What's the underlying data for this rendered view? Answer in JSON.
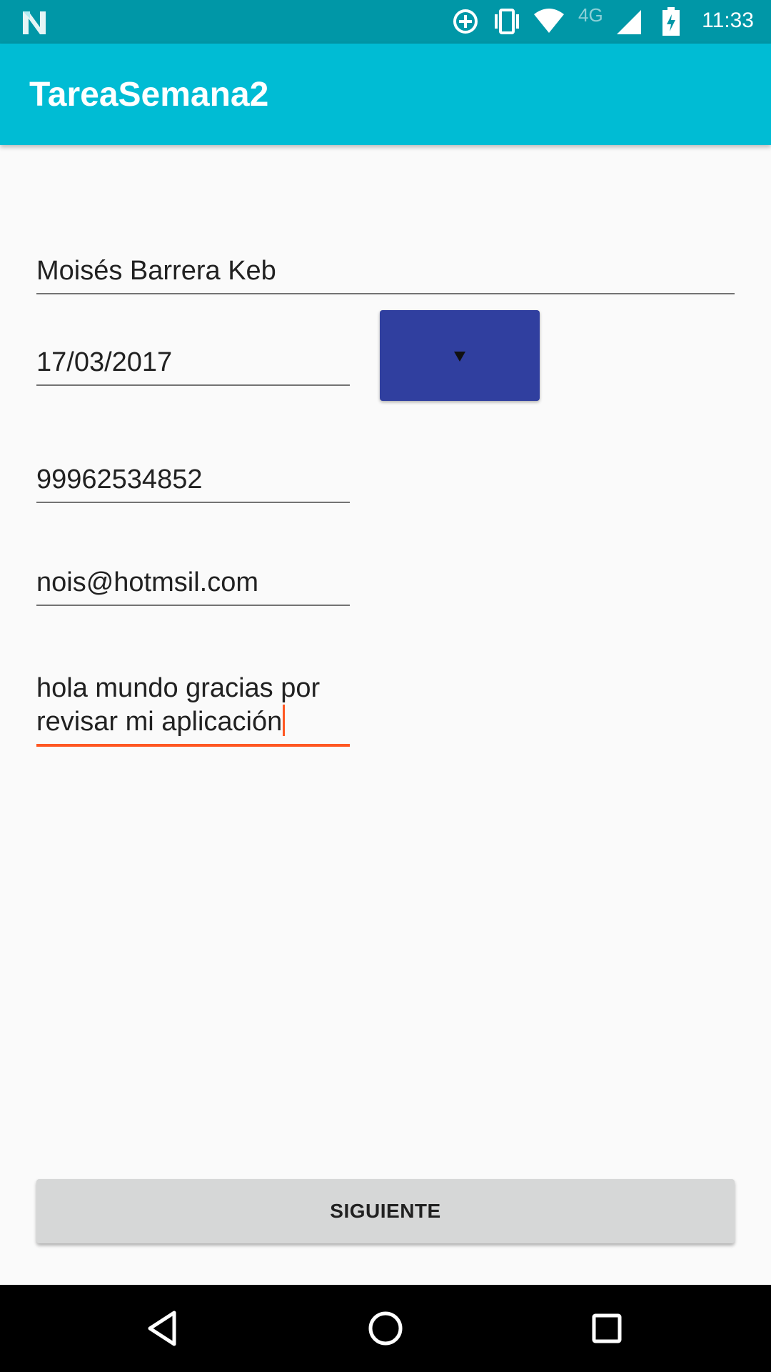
{
  "status_bar": {
    "time": "11:33",
    "network": "4G",
    "icons": [
      "n-logo-icon",
      "data-saver-icon",
      "vibrate-icon",
      "wifi-icon",
      "signal-icon",
      "battery-icon"
    ]
  },
  "app_bar": {
    "title": "TareaSemana2"
  },
  "form": {
    "name": "Moisés Barrera Keb",
    "date": "17/03/2017",
    "phone": "99962534852",
    "email": "nois@hotmsil.com",
    "description": "hola mundo gracias por\nrevisar mi aplicación",
    "spinner_icon": "dropdown-arrow-icon"
  },
  "next_button": {
    "label": "SIGUIENTE"
  },
  "nav_bar": {
    "icons": [
      "back-icon",
      "home-icon",
      "recents-icon"
    ]
  },
  "colors": {
    "status_bar": "#0097a7",
    "app_bar": "#00bcd4",
    "accent": "#ff5722",
    "spinner": "#303f9f",
    "button": "#d6d7d7"
  }
}
